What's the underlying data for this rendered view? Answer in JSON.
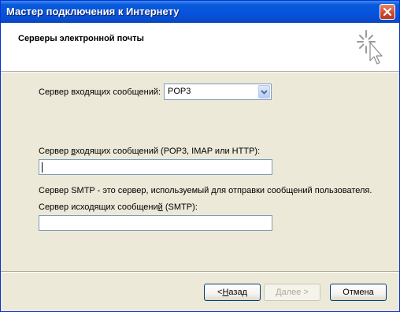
{
  "window": {
    "title": "Мастер подключения к Интернету"
  },
  "header": {
    "title": "Серверы электронной почты"
  },
  "form": {
    "incoming_type_label": "Сервер входящих сообщений:",
    "incoming_type_label_underline": "в",
    "incoming_type_value": "POP3",
    "incoming_server_label_pre": "Сервер ",
    "incoming_server_label_u": "в",
    "incoming_server_label_post": "ходящих сообщений (POP3, IMAP или HTTP):",
    "incoming_server_value": "",
    "smtp_note": "Сервер SMTP - это сервер, используемый для отправки сообщений  пользователя.",
    "outgoing_server_label_pre": "Сервер исходящих сообщени",
    "outgoing_server_label_u": "й",
    "outgoing_server_label_post": " (SMTP):",
    "outgoing_server_value": ""
  },
  "buttons": {
    "back_prefix": "< ",
    "back_u": "Н",
    "back_rest": "азад",
    "next_u": "Д",
    "next_rest": "алее >",
    "cancel": "Отмена"
  },
  "icons": {
    "close": "close-icon",
    "wizard": "wizard-cursor-icon",
    "dropdown": "chevron-down-icon"
  },
  "colors": {
    "titlebar": "#0655e0",
    "close": "#cc4a2c",
    "dialog_bg": "#ece9d8",
    "input_border": "#7f9db9"
  }
}
